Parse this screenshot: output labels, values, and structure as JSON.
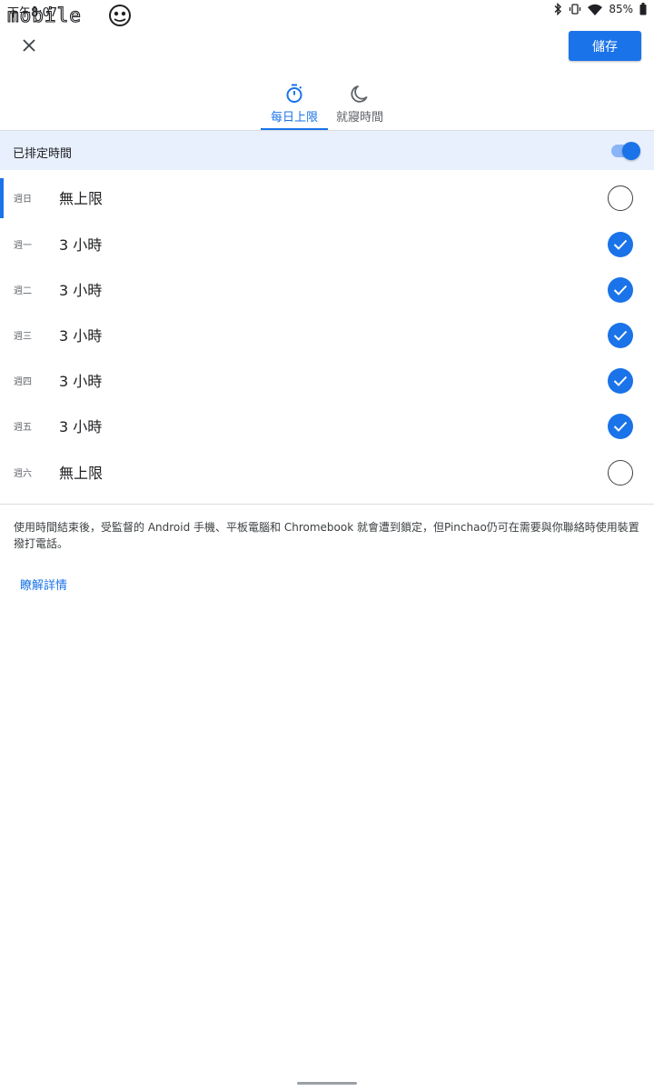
{
  "status_bar": {
    "time": "下午8:07",
    "battery": "85%",
    "watermark": "mobile01"
  },
  "toolbar": {
    "close_label": "Close",
    "save_label": "儲存"
  },
  "tabs": [
    {
      "label": "每日上限",
      "icon": "timer-icon",
      "selected": true
    },
    {
      "label": "就寢時間",
      "icon": "moon-icon",
      "selected": false
    }
  ],
  "schedule": {
    "label": "已排定時間",
    "enabled": true
  },
  "days": [
    {
      "name": "週日",
      "limit": "無上限",
      "checked": false,
      "active": true
    },
    {
      "name": "週一",
      "limit": "3 小時",
      "checked": true,
      "active": false
    },
    {
      "name": "週二",
      "limit": "3 小時",
      "checked": true,
      "active": false
    },
    {
      "name": "週三",
      "limit": "3 小時",
      "checked": true,
      "active": false
    },
    {
      "name": "週四",
      "limit": "3 小時",
      "checked": true,
      "active": false
    },
    {
      "name": "週五",
      "limit": "3 小時",
      "checked": true,
      "active": false
    },
    {
      "name": "週六",
      "limit": "無上限",
      "checked": false,
      "active": false
    }
  ],
  "info_text": "使用時間結束後，受監督的 Android 手機、平板電腦和 Chromebook 就會遭到鎖定，但Pinchao仍可在需要與你聯絡時使用裝置撥打電話。",
  "learn_more": "瞭解詳情",
  "colors": {
    "accent": "#1a73e8",
    "header_bg": "#e8f0fe"
  }
}
